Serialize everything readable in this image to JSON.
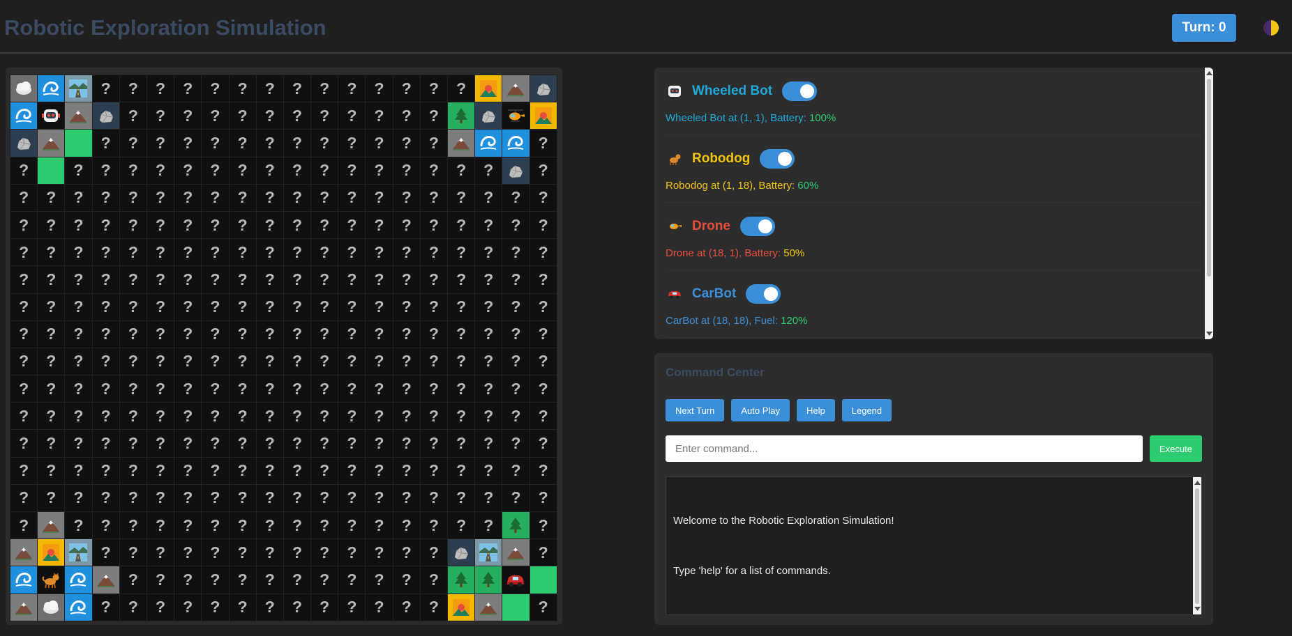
{
  "header": {
    "title": "Robotic Exploration Simulation",
    "turn_label": "Turn: 0",
    "theme_icon": "half-moon-icon"
  },
  "grid": {
    "legend": {
      "?": "unexplored-cell",
      "F": "fog-cloud-icon",
      "W": "water-wave-icon",
      "R": "road-icon",
      "M": "mountain-icon",
      "K": "rock-icon",
      "S": "sunset-icon",
      "T": "tree-icon",
      "G": "grass-cell",
      "B": "wheeled-bot-icon",
      "D": "robodog-icon",
      "H": "drone-icon",
      "C": "carbot-icon"
    },
    "rows": [
      "FWR??????????????SMK",
      "WBMK????????????TKHS",
      "KMG?????????????MWW?",
      "?G????????????????K?",
      "????????????????????",
      "????????????????????",
      "????????????????????",
      "????????????????????",
      "????????????????????",
      "????????????????????",
      "????????????????????",
      "????????????????????",
      "????????????????????",
      "????????????????????",
      "????????????????????",
      "????????????????????",
      "?M????????????????T?",
      "MSR?????????????KRM?",
      "WDWM????????????TTCG",
      "MFW?????????????SMG?"
    ]
  },
  "robots": [
    {
      "name": "Wheeled Bot",
      "icon": "robot-face-icon",
      "color": "#1fa8d8",
      "status": "Wheeled Bot at (1, 1), Battery: ",
      "level_label": "100%",
      "level_color": "#2ecc71",
      "enabled": true
    },
    {
      "name": "Robodog",
      "icon": "dog-icon",
      "color": "#f1c40f",
      "status": "Robodog at (1, 18), Battery: ",
      "level_label": "60%",
      "level_color": "#2ecc71",
      "enabled": true
    },
    {
      "name": "Drone",
      "icon": "helicopter-icon",
      "color": "#e74c3c",
      "status": "Drone at (18, 1), Battery: ",
      "level_label": "50%",
      "level_color": "#f1c40f",
      "enabled": true
    },
    {
      "name": "CarBot",
      "icon": "car-icon",
      "color": "#3b8fd8",
      "status": "CarBot at (18, 18), Fuel: ",
      "level_label": "120%",
      "level_color": "#2ecc71",
      "enabled": true
    }
  ],
  "command_center": {
    "title": "Command Center",
    "buttons": [
      "Next Turn",
      "Auto Play",
      "Help",
      "Legend"
    ],
    "input_placeholder": "Enter command...",
    "execute_label": "Execute",
    "console_lines": [
      "Welcome to the Robotic Exploration Simulation!",
      "Type 'help' for a list of commands."
    ]
  }
}
